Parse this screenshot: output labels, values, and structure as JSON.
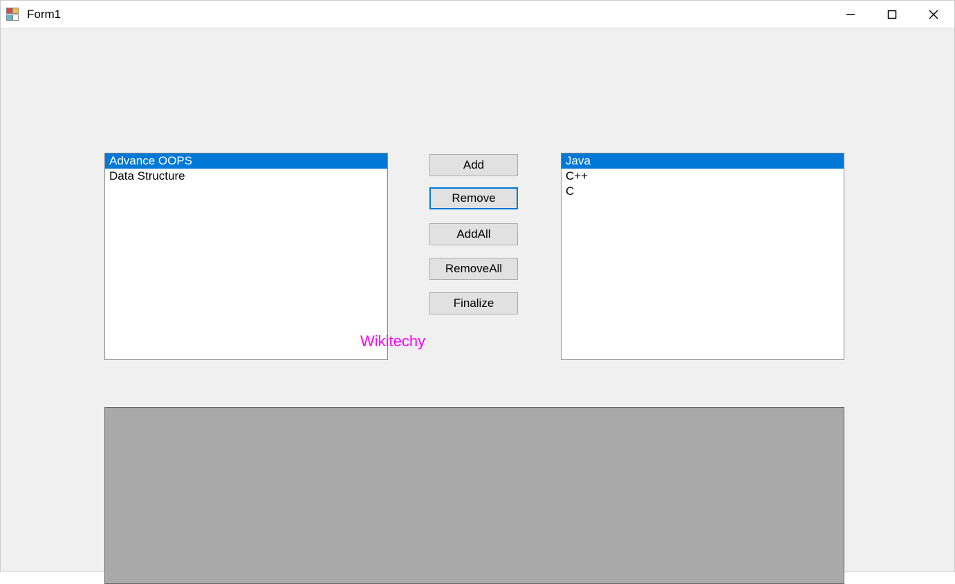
{
  "window": {
    "title": "Form1"
  },
  "leftList": {
    "items": [
      {
        "label": "Advance OOPS",
        "selected": true
      },
      {
        "label": "Data Structure",
        "selected": false
      }
    ]
  },
  "rightList": {
    "items": [
      {
        "label": "Java",
        "selected": true
      },
      {
        "label": "C++",
        "selected": false
      },
      {
        "label": "C",
        "selected": false
      }
    ]
  },
  "buttons": {
    "add": "Add",
    "remove": "Remove",
    "addAll": "AddAll",
    "removeAll": "RemoveAll",
    "finalize": "Finalize"
  },
  "watermark": "Wikitechy"
}
